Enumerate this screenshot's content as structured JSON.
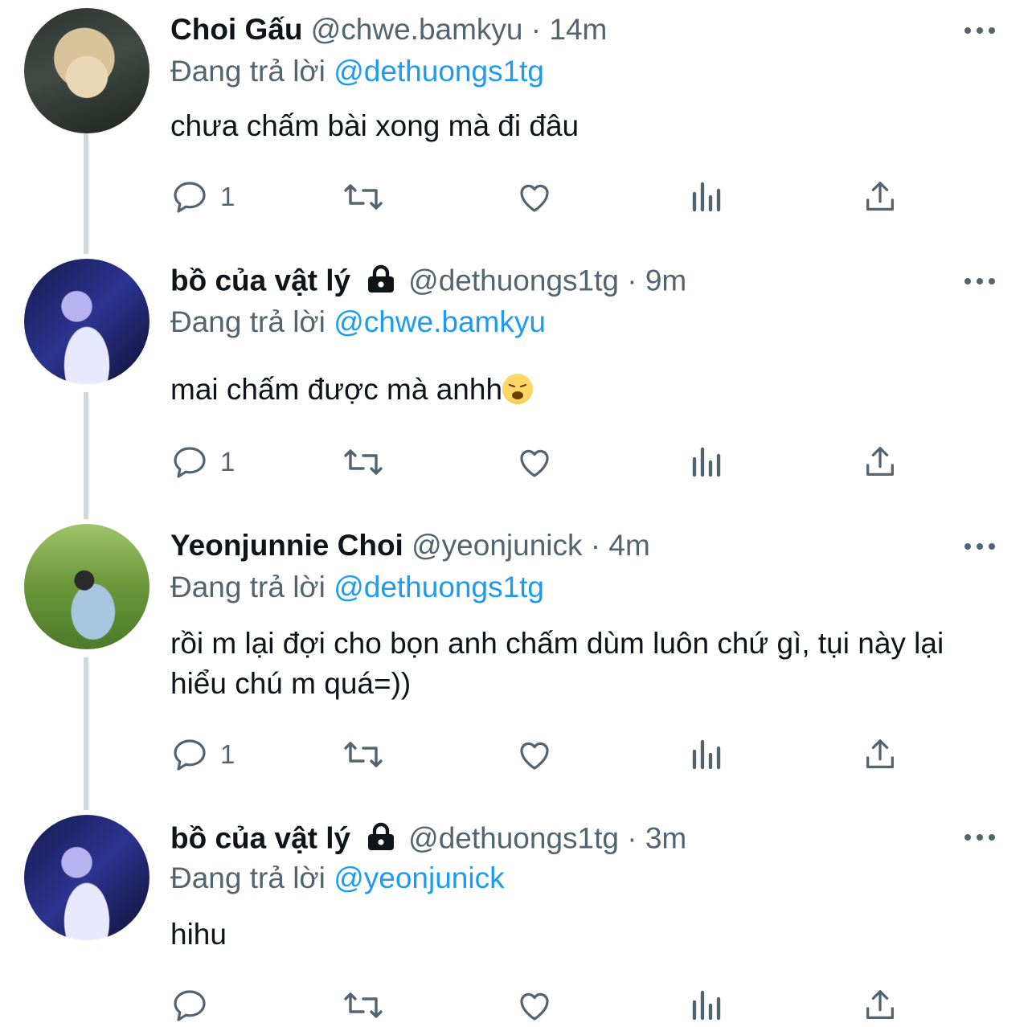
{
  "tweets": [
    {
      "name": "Choi Gấu",
      "handle": "@chwe.bamkyu",
      "sep": "·",
      "time": "14m",
      "reply_prefix": "Đang trả lời",
      "reply_to": "@dethuongs1tg",
      "text": "chưa chấm bài xong mà đi đâu",
      "reply_count": "1",
      "locked": false
    },
    {
      "name": "bồ của vật lý",
      "handle": "@dethuongs1tg",
      "sep": "·",
      "time": "9m",
      "reply_prefix": "Đang trả lời",
      "reply_to": "@chwe.bamkyu",
      "text": "mai chấm được mà anhh",
      "reply_count": "1",
      "locked": true
    },
    {
      "name": "Yeonjunnie Choi",
      "handle": "@yeonjunick",
      "sep": "·",
      "time": "4m",
      "reply_prefix": "Đang trả lời",
      "reply_to": "@dethuongs1tg",
      "text": "rồi m lại đợi cho bọn anh chấm dùm luôn chứ gì, tụi này lại hiểu chú m quá=))",
      "reply_count": "1",
      "locked": false
    },
    {
      "name": "bồ của vật lý",
      "handle": "@dethuongs1tg",
      "sep": "·",
      "time": "3m",
      "reply_prefix": "Đang trả lời",
      "reply_to": "@yeonjunick",
      "text": "hihu",
      "reply_count": "",
      "locked": true
    }
  ],
  "icons": {
    "reply": "reply-icon",
    "retweet": "retweet-icon",
    "like": "heart-icon",
    "views": "views-icon",
    "share": "share-icon",
    "more": "more-icon",
    "lock": "lock-icon",
    "emoji": "weary-face-emoji"
  },
  "colors": {
    "text": "#0f1419",
    "secondary": "#536471",
    "mention": "#1d9bf0",
    "thread_line": "#cfd9de"
  }
}
